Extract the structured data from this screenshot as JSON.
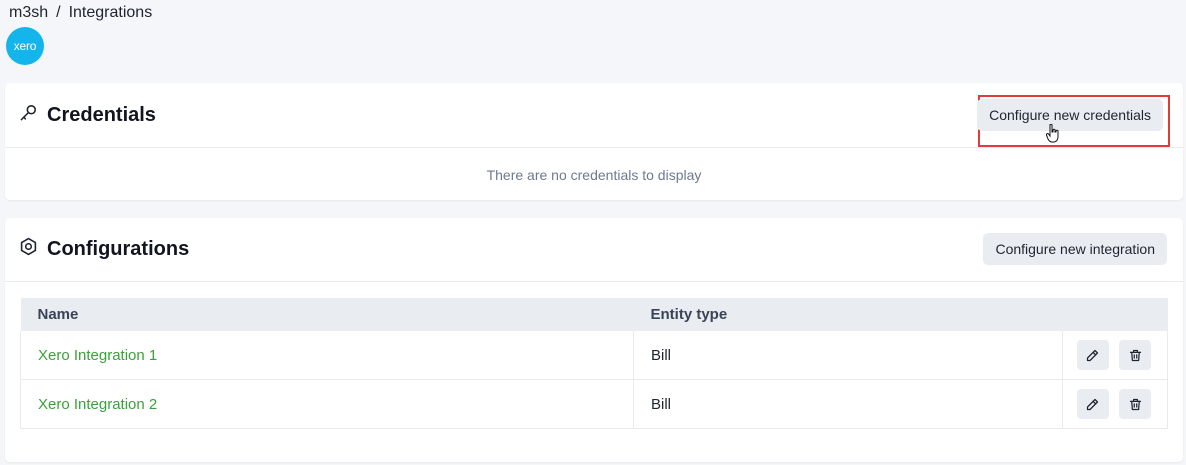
{
  "breadcrumb": {
    "org": "m3sh",
    "separator": "/",
    "page": "Integrations"
  },
  "logo": {
    "text": "xero",
    "color": "#13b5ea"
  },
  "credentials": {
    "title": "Credentials",
    "icon": "key-icon",
    "button_label": "Configure new credentials",
    "empty_message": "There are no credentials to display"
  },
  "configurations": {
    "title": "Configurations",
    "icon": "hexagon-nut-icon",
    "button_label": "Configure new integration",
    "columns": {
      "name": "Name",
      "entity_type": "Entity type"
    },
    "rows": [
      {
        "name": "Xero Integration 1",
        "entity_type": "Bill"
      },
      {
        "name": "Xero Integration 2",
        "entity_type": "Bill"
      }
    ]
  },
  "colors": {
    "link": "#3aa23a",
    "highlight": "#e23b3b",
    "button_bg": "#e9edf2"
  }
}
